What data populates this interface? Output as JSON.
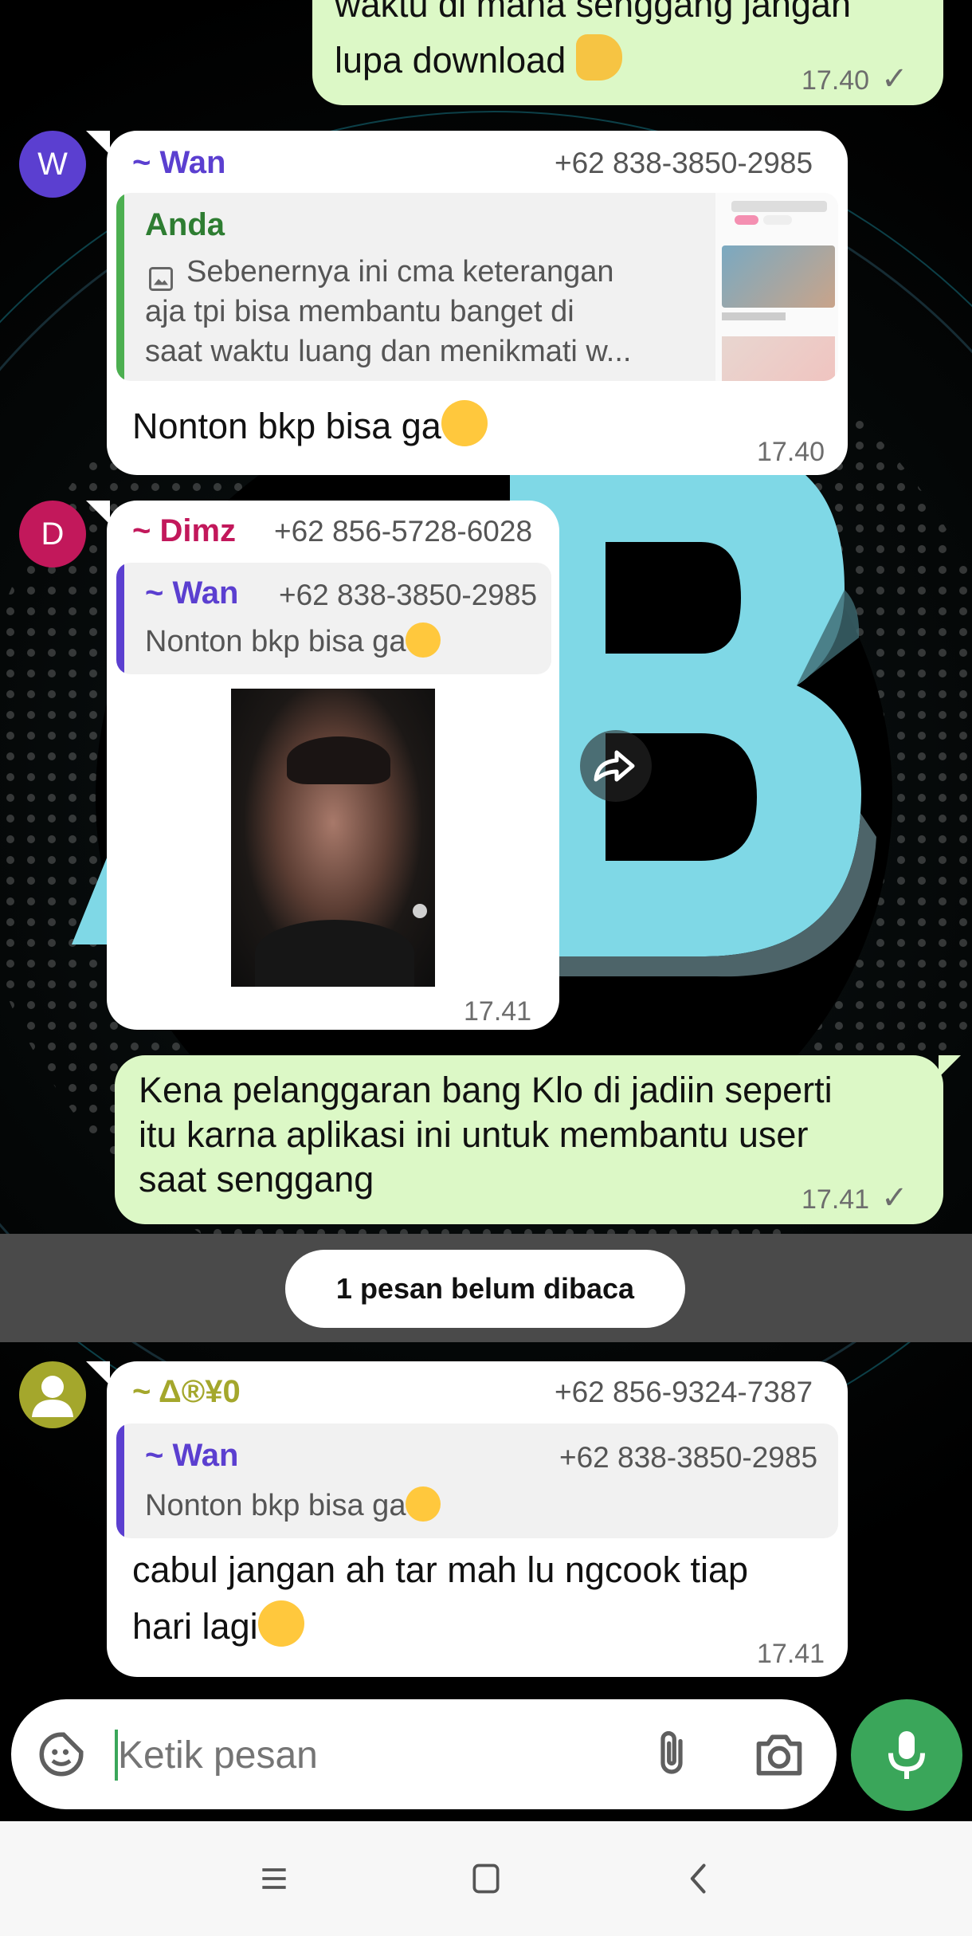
{
  "messages": {
    "m1": {
      "text_line1": "waktu di mana senggang jangan",
      "text_line2": "lupa download",
      "time": "17.40",
      "tick": "✓"
    },
    "m2": {
      "avatar_letter": "W",
      "sender": "~ Wan",
      "phone": "+62 838-3850-2985",
      "quote_sender": "Anda",
      "quote_line1": "Sebenernya ini cma keterangan",
      "quote_line2": "aja tpi bisa membantu banget di",
      "quote_line3": "saat waktu luang dan menikmati w...",
      "text": "Nonton bkp bisa ga",
      "time": "17.40"
    },
    "m3": {
      "avatar_letter": "D",
      "sender": "~ Dimz",
      "phone": "+62 856-5728-6028",
      "quote_sender": "~ Wan",
      "quote_phone": "+62 838-3850-2985",
      "quote_text": "Nonton bkp bisa ga",
      "time": "17.41"
    },
    "m4": {
      "line1": "Kena pelanggaran bang Klo di jadiin seperti",
      "line2": "itu karna aplikasi ini untuk membantu user",
      "line3": "saat senggang",
      "time": "17.41",
      "tick": "✓"
    },
    "m5": {
      "sender": "~ Δ®¥0",
      "phone": "+62 856-9324-7387",
      "quote_sender": "~ Wan",
      "quote_phone": "+62 838-3850-2985",
      "quote_text": "Nonton bkp bisa ga",
      "line1": "cabul jangan ah tar mah lu ngcook tiap",
      "line2": "hari lagi",
      "time": "17.41"
    }
  },
  "unread": {
    "label": "1 pesan belum dibaca"
  },
  "composer": {
    "placeholder": "Ketik pesan"
  },
  "colors": {
    "wan": "#5b3fd0",
    "dimz": "#c2185b",
    "delta": "#a4a72c",
    "out_bubble": "#dcf8c6",
    "mic": "#3aa65a",
    "quote_bar_self": "#4caf50"
  },
  "icons": [
    "thumbs-up-emoji",
    "hand-over-mouth-emoji",
    "tears-of-joy-emoji",
    "image-icon",
    "forward-icon",
    "sticker-icon",
    "attach-icon",
    "camera-icon",
    "mic-icon",
    "menu-icon",
    "home-icon",
    "back-icon"
  ]
}
